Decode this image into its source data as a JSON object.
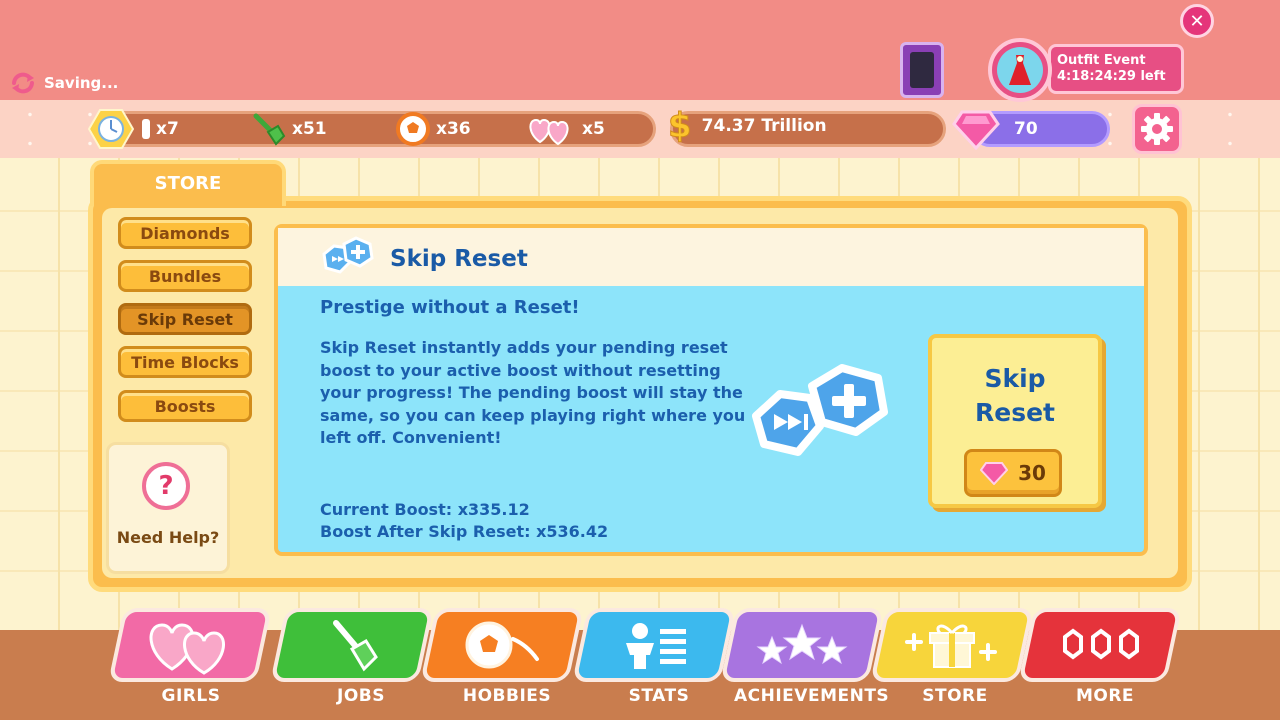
{
  "status": {
    "saving": "Saving..."
  },
  "close_label": "✕",
  "event": {
    "title": "Outfit Event",
    "time_left": "4:18:24:29 left"
  },
  "resources": {
    "time_count": "x7",
    "shovel_count": "x51",
    "ball_count": "x36",
    "hearts_count": "x5",
    "money_symbol": "$",
    "money": "74.37 Trillion",
    "diamonds": "70"
  },
  "store": {
    "tab_label": "STORE",
    "sidebar": [
      {
        "label": "Diamonds"
      },
      {
        "label": "Bundles"
      },
      {
        "label": "Skip Reset"
      },
      {
        "label": "Time Blocks"
      },
      {
        "label": "Boosts"
      }
    ],
    "help_label": "Need Help?",
    "help_glyph": "?"
  },
  "product": {
    "title": "Skip Reset",
    "subhead": "Prestige without a Reset!",
    "description": "Skip Reset instantly adds your pending reset boost to your active boost without resetting your progress! The pending boost will stay the same, so you can keep playing right where you left off. Convenient!",
    "current_boost": "Current Boost: x335.12",
    "boost_after": "Boost After Skip Reset: x536.42",
    "buy_title_line1": "Skip",
    "buy_title_line2": "Reset",
    "price": "30"
  },
  "nav": [
    {
      "label": "GIRLS",
      "color": "#f26aa6"
    },
    {
      "label": "JOBS",
      "color": "#3fbf3a"
    },
    {
      "label": "HOBBIES",
      "color": "#f67f22"
    },
    {
      "label": "STATS",
      "color": "#3cb9ee"
    },
    {
      "label": "ACHIEVEMENTS",
      "color": "#a874e0"
    },
    {
      "label": "STORE",
      "color": "#f7d53b"
    },
    {
      "label": "MORE",
      "color": "#e5333b"
    }
  ]
}
